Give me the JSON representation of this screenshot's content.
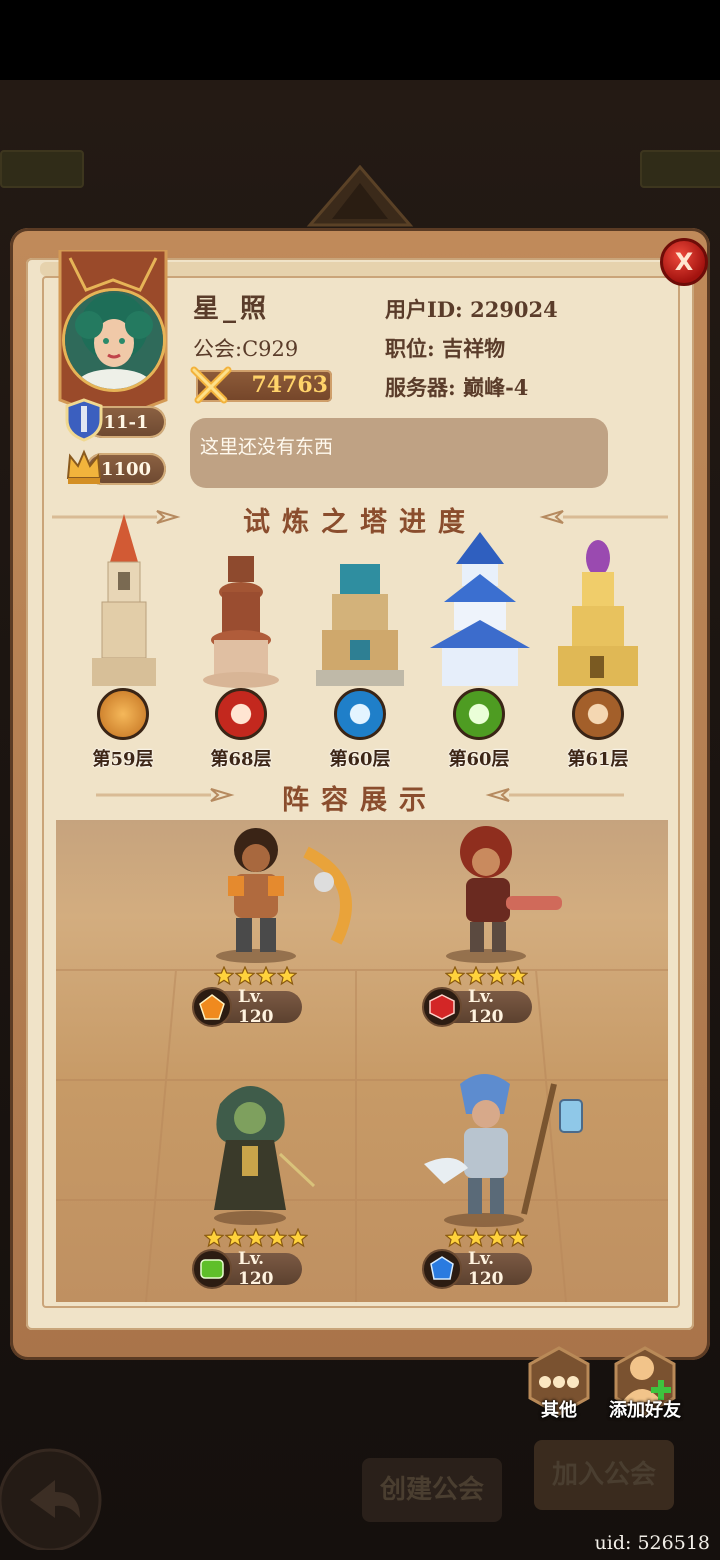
{
  "player": {
    "name": "星_照",
    "guild": "公会:C929",
    "power": "74763",
    "user_id": "用户ID: 229024",
    "position": "职位: 吉祥物",
    "server": "服务器: 巅峰-4",
    "stage": "11-1",
    "crowns": "1100",
    "motto": "这里还没有东西"
  },
  "tower_section": {
    "title": "试炼之塔进度",
    "towers": [
      {
        "floor": "第59层",
        "color": "#d2842f"
      },
      {
        "floor": "第68层",
        "color": "#c3281e"
      },
      {
        "floor": "第60层",
        "color": "#1f7fc9"
      },
      {
        "floor": "第60层",
        "color": "#5fae2a"
      },
      {
        "floor": "第61层",
        "color": "#b06a2f"
      }
    ]
  },
  "lineup_section": {
    "title": "阵容展示",
    "heroes": [
      {
        "level": "Lv. 120",
        "stars": 4,
        "gem": "orange"
      },
      {
        "level": "Lv. 120",
        "stars": 4,
        "gem": "red"
      },
      {
        "level": "Lv. 120",
        "stars": 5,
        "gem": "green"
      },
      {
        "level": "Lv. 120",
        "stars": 4,
        "gem": "blue"
      }
    ]
  },
  "actions": {
    "other": "其他",
    "add_friend": "添加好友"
  },
  "background": {
    "create_guild": "创建公会",
    "join_guild": "加入公会"
  },
  "uid": "uid: 526518",
  "close_label": "X"
}
